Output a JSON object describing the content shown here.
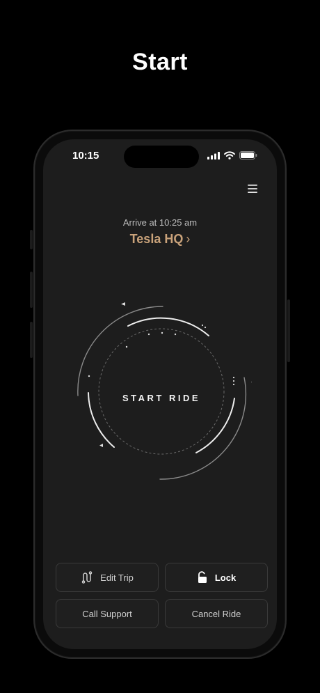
{
  "headline": "Start",
  "status_bar": {
    "time": "10:15"
  },
  "trip": {
    "arrive_text": "Arrive at 10:25 am",
    "destination": "Tesla HQ",
    "destination_chevron": "›"
  },
  "dial": {
    "label": "START RIDE"
  },
  "actions": {
    "edit_trip": "Edit Trip",
    "lock": "Lock",
    "call_support": "Call Support",
    "cancel_ride": "Cancel Ride"
  },
  "colors": {
    "background": "#000000",
    "screen": "#1d1d1d",
    "accent_gold": "#c9a27a",
    "button_border": "#3a3a3a"
  },
  "icons": [
    "signal-icon",
    "wifi-icon",
    "battery-icon",
    "menu-icon",
    "chevron-right-icon",
    "route-icon",
    "unlock-icon"
  ]
}
